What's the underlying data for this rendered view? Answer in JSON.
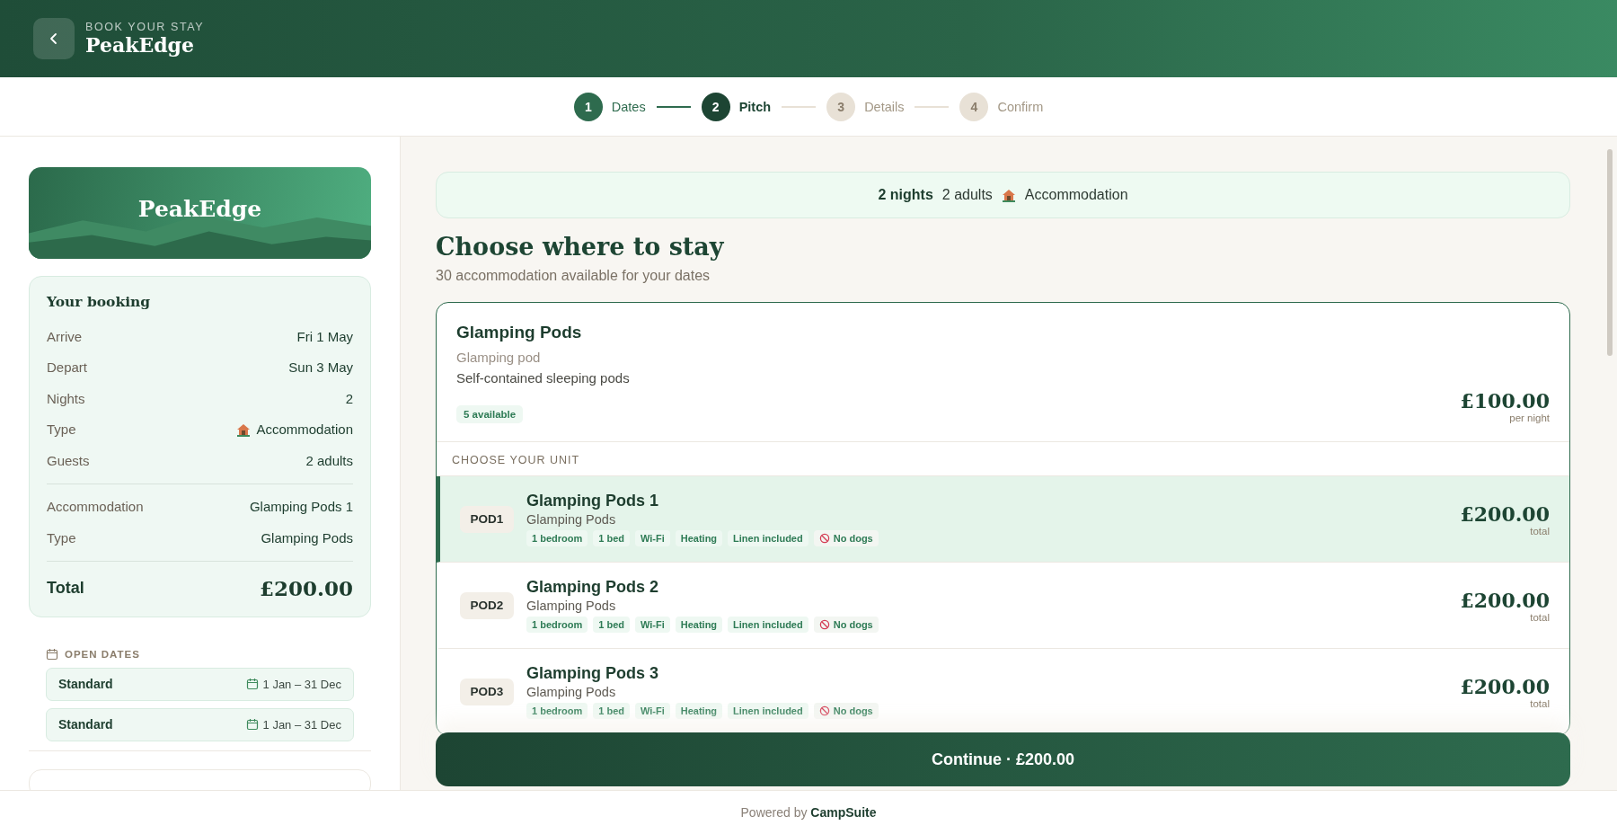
{
  "header": {
    "eyebrow": "BOOK YOUR STAY",
    "title": "PeakEdge"
  },
  "steps": [
    {
      "number": "1",
      "label": "Dates",
      "completed": true,
      "selected": false
    },
    {
      "number": "2",
      "label": "Pitch",
      "completed": false,
      "selected": true
    },
    {
      "number": "3",
      "label": "Details",
      "completed": false,
      "selected": false
    },
    {
      "number": "4",
      "label": "Confirm",
      "completed": false,
      "selected": false
    }
  ],
  "sidebar": {
    "logo_title": "PeakEdge",
    "booking": {
      "title": "Your booking",
      "rows": [
        {
          "label": "Arrive",
          "value": "Fri 1 May",
          "kind": "plain"
        },
        {
          "label": "Depart",
          "value": "Sun 3 May",
          "kind": "plain"
        },
        {
          "label": "Nights",
          "value": "2",
          "kind": "plain"
        },
        {
          "label": "Type",
          "value": "Accommodation",
          "kind": "with-icon"
        },
        {
          "label": "Guests",
          "value": "2 adults",
          "kind": "plain"
        }
      ],
      "details": [
        {
          "label": "Accommodation",
          "value": "Glamping Pods 1"
        },
        {
          "label": "Type",
          "value": "Glamping Pods"
        }
      ],
      "total_label": "Total",
      "total_value": "£200.00"
    },
    "open_dates": {
      "title": "OPEN DATES",
      "items": [
        {
          "name": "Standard",
          "range": "1 Jan – 31 Dec"
        },
        {
          "name": "Standard",
          "range": "1 Jan – 31 Dec"
        }
      ]
    }
  },
  "main": {
    "summary": {
      "nights": "2 nights",
      "adults": "2 adults",
      "type": "Accommodation"
    },
    "title": "Choose where to stay",
    "subtitle": "30 accommodation available for your dates",
    "group": {
      "name": "Glamping Pods",
      "type": "Glamping pod",
      "description": "Self-contained sleeping pods",
      "availability": "5 available",
      "price": "£100.00",
      "price_unit": "per night",
      "units_label": "CHOOSE YOUR UNIT",
      "units": [
        {
          "code": "POD1",
          "name": "Glamping Pods 1",
          "type": "Glamping Pods",
          "selected": true,
          "price": "£200.00",
          "price_unit": "total",
          "tags": [
            {
              "text": "1 bedroom",
              "kind": "feature"
            },
            {
              "text": "1 bed",
              "kind": "feature"
            },
            {
              "text": "Wi-Fi",
              "kind": "feature"
            },
            {
              "text": "Heating",
              "kind": "feature"
            },
            {
              "text": "Linen included",
              "kind": "feature"
            },
            {
              "text": "No dogs",
              "kind": "restriction"
            }
          ]
        },
        {
          "code": "POD2",
          "name": "Glamping Pods 2",
          "type": "Glamping Pods",
          "selected": false,
          "price": "£200.00",
          "price_unit": "total",
          "tags": [
            {
              "text": "1 bedroom",
              "kind": "feature"
            },
            {
              "text": "1 bed",
              "kind": "feature"
            },
            {
              "text": "Wi-Fi",
              "kind": "feature"
            },
            {
              "text": "Heating",
              "kind": "feature"
            },
            {
              "text": "Linen included",
              "kind": "feature"
            },
            {
              "text": "No dogs",
              "kind": "restriction"
            }
          ]
        },
        {
          "code": "POD3",
          "name": "Glamping Pods 3",
          "type": "Glamping Pods",
          "selected": false,
          "price": "£200.00",
          "price_unit": "total",
          "tags": [
            {
              "text": "1 bedroom",
              "kind": "feature"
            },
            {
              "text": "1 bed",
              "kind": "feature"
            },
            {
              "text": "Wi-Fi",
              "kind": "feature"
            },
            {
              "text": "Heating",
              "kind": "feature"
            },
            {
              "text": "Linen included",
              "kind": "feature"
            },
            {
              "text": "No dogs",
              "kind": "restriction"
            }
          ]
        }
      ]
    },
    "continue_label": "Continue · £200.00"
  },
  "footer": {
    "prefix": "Powered by",
    "brand": "CampSuite"
  }
}
